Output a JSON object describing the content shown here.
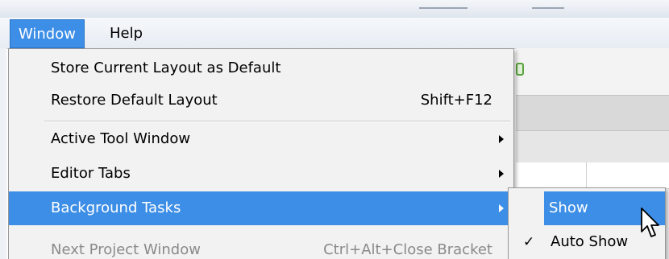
{
  "menubar": {
    "items": [
      {
        "label": "Window",
        "active": true
      },
      {
        "label": "Help",
        "active": false
      }
    ]
  },
  "window_menu": {
    "items": [
      {
        "label": "Store Current Layout as Default",
        "shortcut": "",
        "submenu": false,
        "state": "normal"
      },
      {
        "label": "Restore Default Layout",
        "shortcut": "Shift+F12",
        "submenu": false,
        "state": "normal"
      },
      {
        "label": "Active Tool Window",
        "shortcut": "",
        "submenu": true,
        "state": "normal"
      },
      {
        "label": "Editor Tabs",
        "shortcut": "",
        "submenu": true,
        "state": "normal"
      },
      {
        "label": "Background Tasks",
        "shortcut": "",
        "submenu": true,
        "state": "highlighted"
      },
      {
        "label": "Next Project Window",
        "shortcut": "Ctrl+Alt+Close Bracket",
        "submenu": false,
        "state": "disabled"
      }
    ]
  },
  "background_tasks_submenu": {
    "items": [
      {
        "label": "Show",
        "checked": false,
        "state": "highlighted"
      },
      {
        "label": "Auto Show",
        "checked": true,
        "check_mark": "✓",
        "state": "normal"
      }
    ]
  },
  "colors": {
    "highlight": "#3d8ee6",
    "menu_bg": "#f2f2f2",
    "disabled_text": "#8a8a8a"
  },
  "icons": {
    "submenu_arrow": "chevron-right-icon",
    "check": "check-icon",
    "cursor": "mouse-pointer-icon"
  }
}
